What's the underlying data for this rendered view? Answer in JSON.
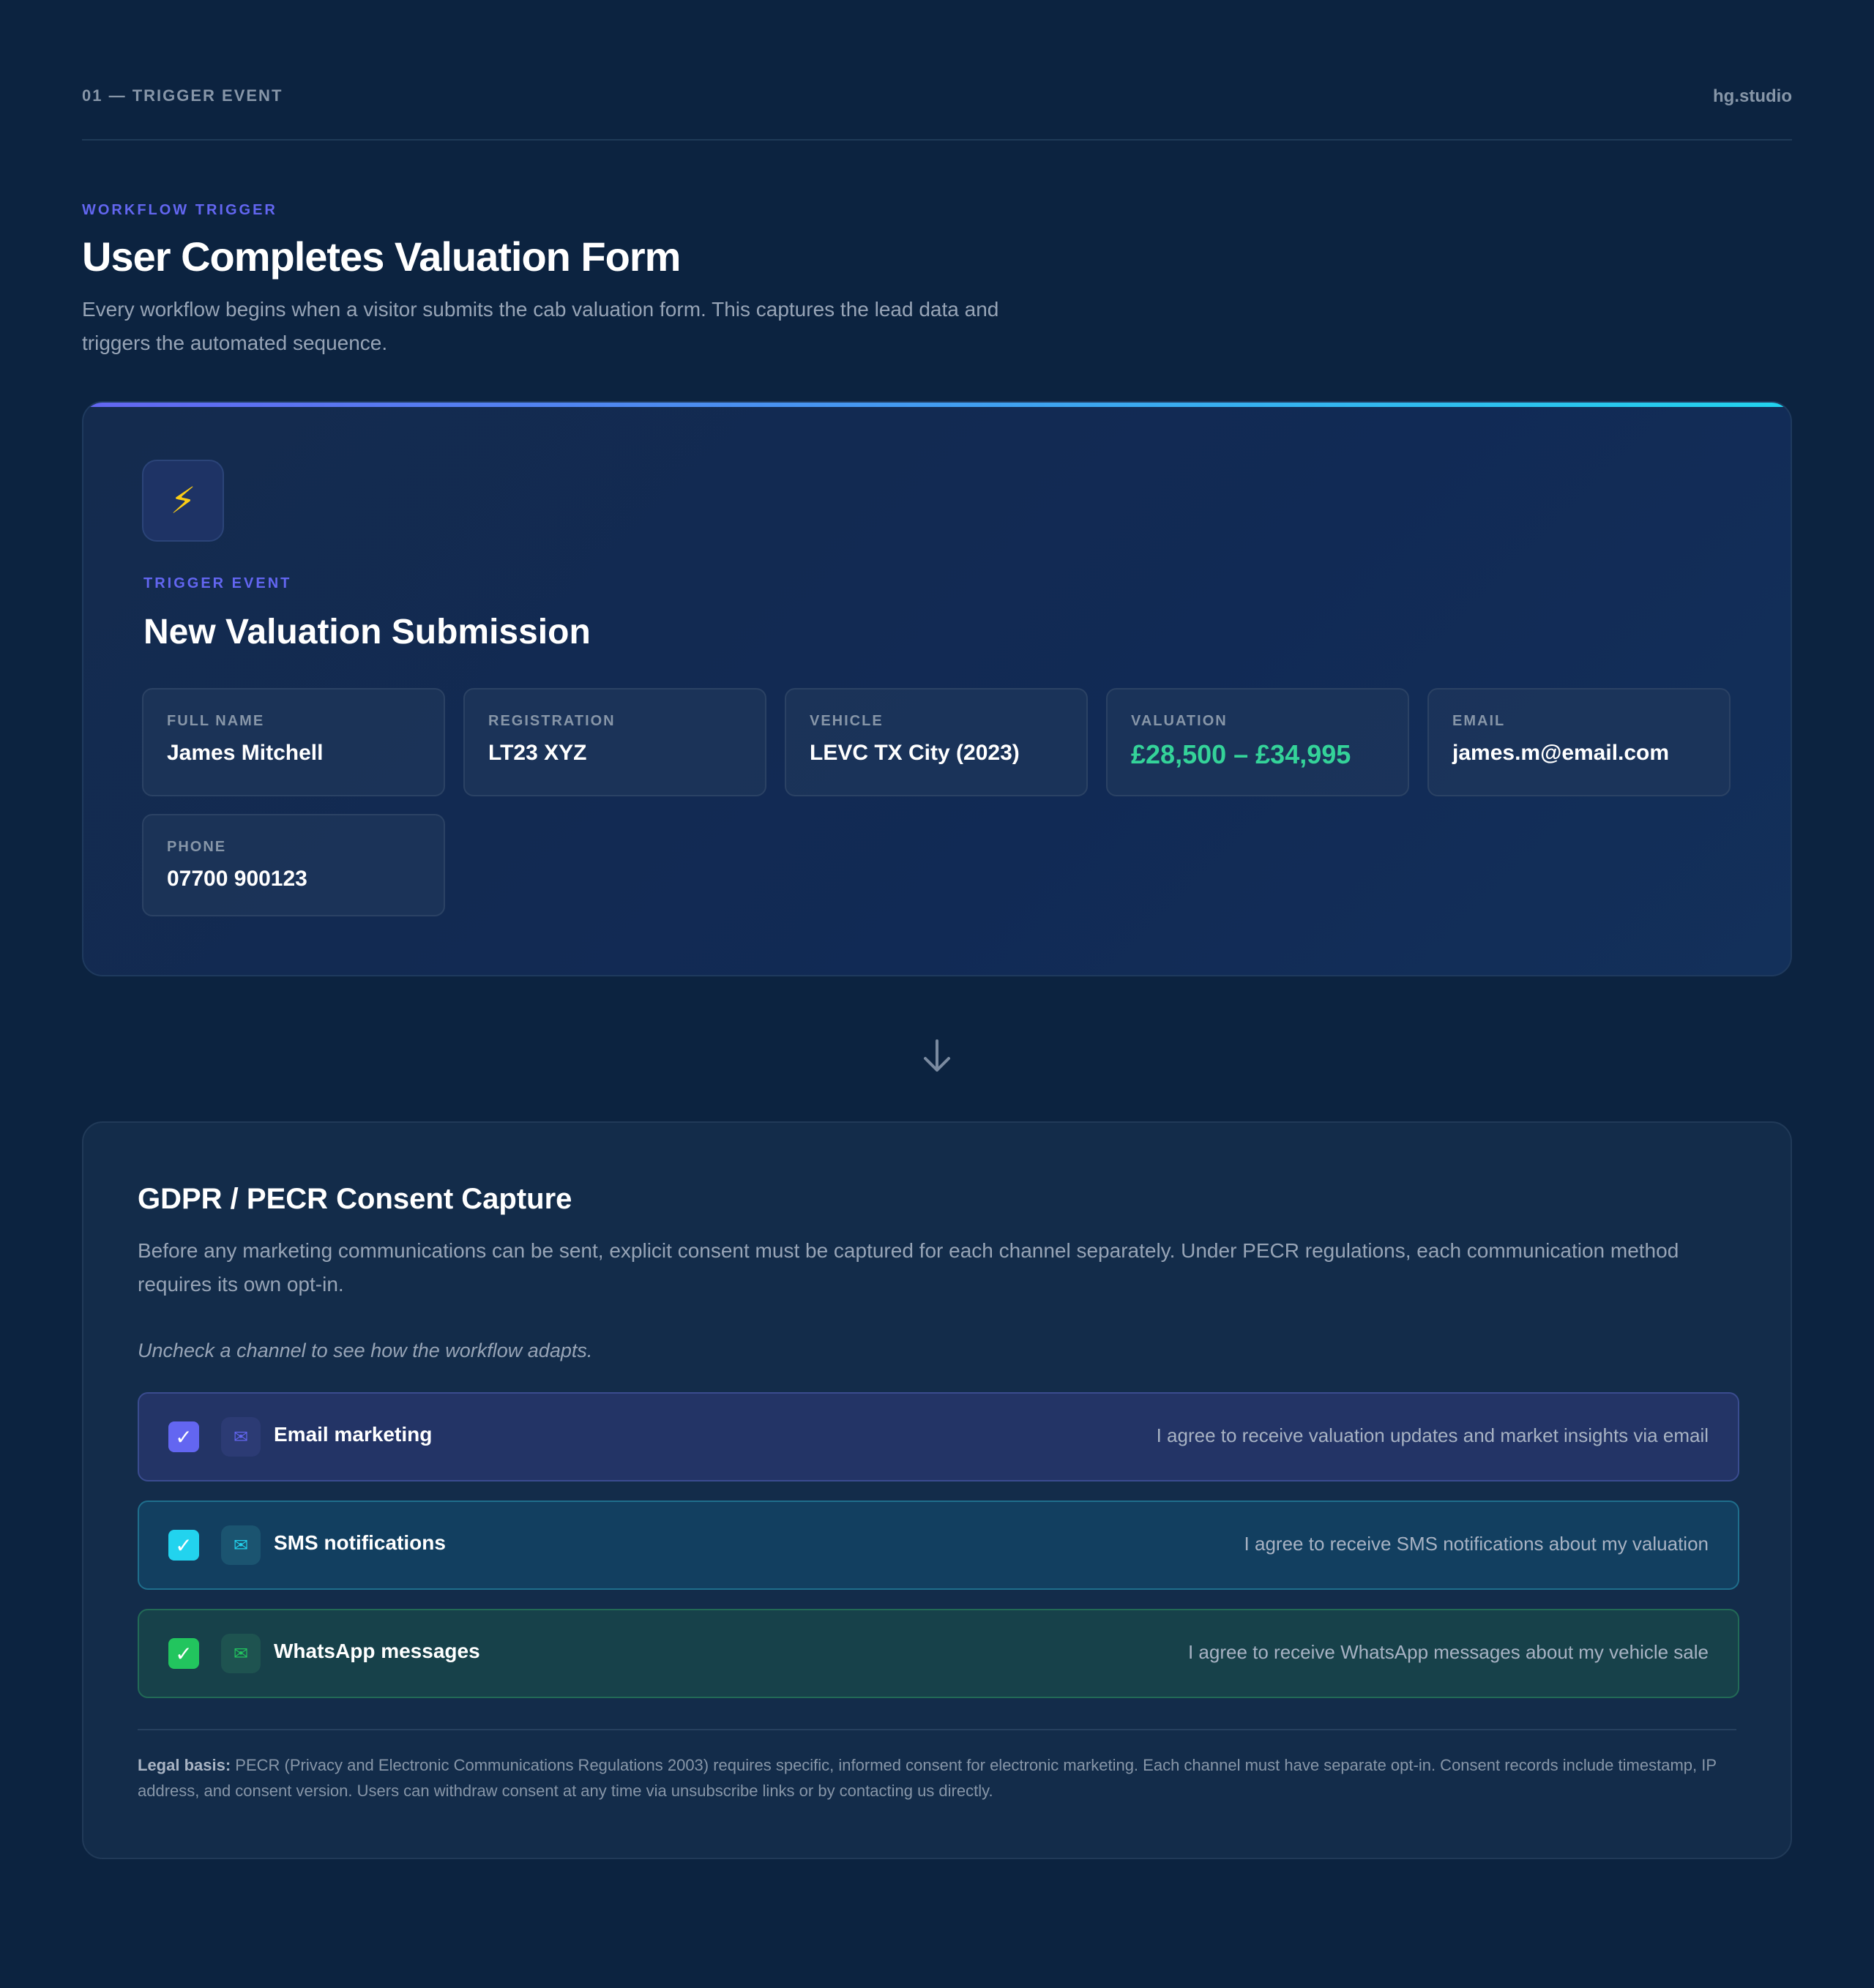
{
  "header": {
    "step_label": "01 — TRIGGER EVENT",
    "brand": "hg.studio"
  },
  "intro": {
    "eyebrow": "WORKFLOW TRIGGER",
    "title": "User Completes Valuation Form",
    "description": "Every workflow begins when a visitor submits the cab valuation form. This captures the lead data and triggers the automated sequence."
  },
  "trigger": {
    "icon": "lightning-icon",
    "eyebrow": "TRIGGER EVENT",
    "title": "New Valuation Submission",
    "fields": [
      {
        "label": "FULL NAME",
        "value": "James Mitchell"
      },
      {
        "label": "REGISTRATION",
        "value": "LT23 XYZ"
      },
      {
        "label": "VEHICLE",
        "value": "LEVC TX City (2023)"
      },
      {
        "label": "VALUATION",
        "value": "£28,500 – £34,995"
      },
      {
        "label": "EMAIL",
        "value": "james.m@email.com"
      },
      {
        "label": "PHONE",
        "value": "07700 900123"
      }
    ]
  },
  "flow": {
    "icon": "arrow-down-icon"
  },
  "consent": {
    "title": "GDPR / PECR Consent Capture",
    "description": "Before any marketing communications can be sent, explicit consent must be captured for each channel separately. Under PECR regulations, each communication method requires its own opt-in.",
    "hint": "Uncheck a channel to see how the workflow adapts.",
    "channels": [
      {
        "name": "Email marketing",
        "description": "I agree to receive valuation updates and market insights via email",
        "checked": true,
        "icon": "envelope-icon",
        "color": "#6366f1"
      },
      {
        "name": "SMS notifications",
        "description": "I agree to receive SMS notifications about my valuation",
        "checked": true,
        "icon": "envelope-icon",
        "color": "#22d3ee"
      },
      {
        "name": "WhatsApp messages",
        "description": "I agree to receive WhatsApp messages about my vehicle sale",
        "checked": true,
        "icon": "envelope-icon",
        "color": "#22c55e"
      }
    ],
    "legal_label": "Legal basis:",
    "legal_text": "PECR (Privacy and Electronic Communications Regulations 2003) requires specific, informed consent for electronic marketing. Each channel must have separate opt-in. Consent records include timestamp, IP address, and consent version. Users can withdraw consent at any time via unsubscribe links or by contacting us directly."
  },
  "glyphs": {
    "lightning": "⚡",
    "check": "✓",
    "envelope": "✉"
  }
}
